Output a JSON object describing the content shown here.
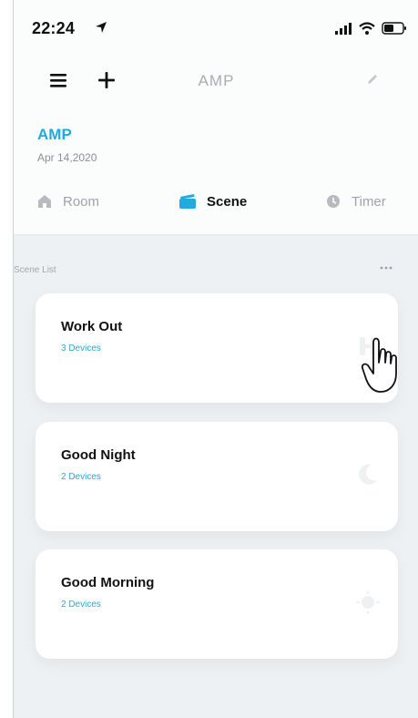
{
  "status_bar": {
    "time": "22:24",
    "icons": [
      "location-arrow-icon",
      "signal-icon",
      "wifi-icon",
      "battery-icon"
    ]
  },
  "nav": {
    "title": "AMP",
    "icons": [
      "menu-icon",
      "add-icon",
      "edit-icon"
    ]
  },
  "home": {
    "name": "AMP",
    "date": "Apr 14,2020"
  },
  "tabs": [
    {
      "label": "Room",
      "icon": "house-icon",
      "active": false
    },
    {
      "label": "Scene",
      "icon": "scene-icon",
      "active": true
    },
    {
      "label": "Timer",
      "icon": "clock-icon",
      "active": false
    }
  ],
  "section": {
    "label": "Scene List",
    "more_icon": "ellipsis-icon"
  },
  "scenes": [
    {
      "name": "Work Out",
      "devices": "3 Devices",
      "icon": "dumbbell-icon"
    },
    {
      "name": "Good Night",
      "devices": "2 Devices",
      "icon": "moon-icon"
    },
    {
      "name": "Good Morning",
      "devices": "2 Devices",
      "icon": "sun-icon"
    }
  ],
  "colors": {
    "accent": "#22a9dd",
    "background": "#eef1f3",
    "card": "#ffffff"
  }
}
